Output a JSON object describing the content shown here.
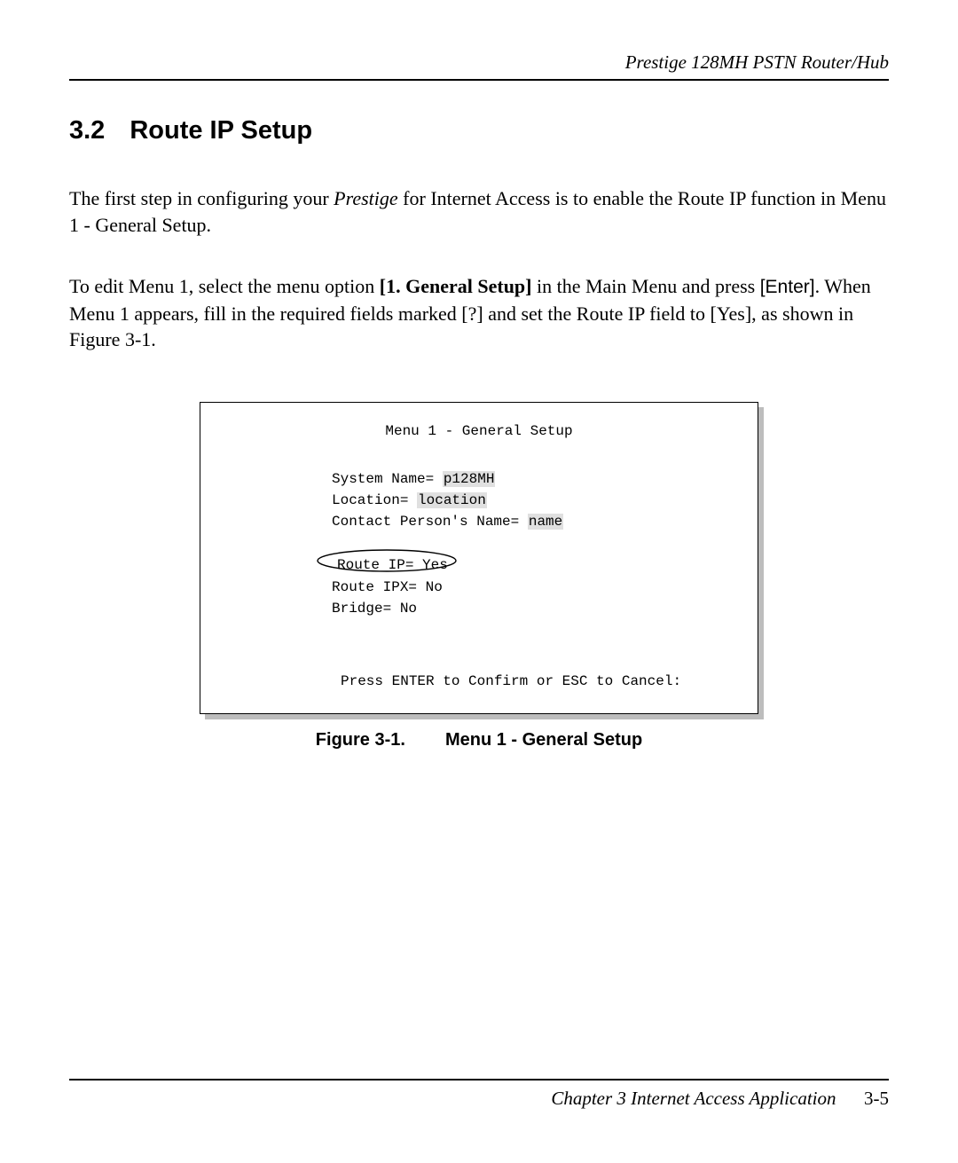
{
  "header": {
    "product_line": "Prestige 128MH    PSTN Router/Hub"
  },
  "section": {
    "number": "3.2",
    "title": "Route IP Setup"
  },
  "para1": {
    "pre": "The first step in configuring your ",
    "em": "Prestige",
    "post": " for Internet Access is to enable the Route IP function in Menu 1 - General Setup."
  },
  "para2": {
    "pre": "To edit Menu 1, select the menu option ",
    "bold": "[1. General Setup]",
    "mid": " in the Main Menu and press ",
    "key": "[Enter]",
    "tail": ". When Menu 1 appears, fill in the required fields marked [?] and set the Route IP field to [Yes], as shown in Figure 3-1."
  },
  "figure": {
    "title": "Menu 1 - General Setup",
    "fields": {
      "system_name_label": "System Name= ",
      "system_name_value": "p128MH",
      "location_label": "Location= ",
      "location_value": "location",
      "contact_label": "Contact Person's Name= ",
      "contact_value": "name"
    },
    "routes": {
      "route_ip": "Route IP= Yes",
      "route_ipx": "Route IPX= No",
      "bridge": "Bridge= No"
    },
    "prompt": "Press ENTER to Confirm or ESC to Cancel:"
  },
  "caption": {
    "fignum": "Figure 3-1.",
    "text": "Menu 1 - General Setup"
  },
  "footer": {
    "chapter_label": "Chapter 3",
    "chapter_title": "Internet Access Application",
    "page_number": "3-5"
  }
}
